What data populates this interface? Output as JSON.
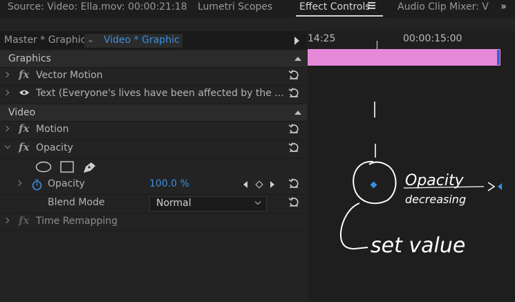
{
  "tabs": [
    {
      "label": "Source: Video: Ella.mov: 00:00:21:18"
    },
    {
      "label": "Lumetri Scopes"
    },
    {
      "label": "Effect Controls"
    },
    {
      "label": "Audio Clip Mixer: V"
    }
  ],
  "sequence_tabs": {
    "master": "Master * Graphic",
    "video": "Video * Graphic"
  },
  "sections": {
    "graphics": "Graphics",
    "video": "Video"
  },
  "graphics_rows": [
    {
      "label": "Vector Motion"
    },
    {
      "label": "Text (Everyone's lives have been affected by the ..."
    }
  ],
  "video_rows": {
    "motion": "Motion",
    "opacity": "Opacity",
    "time_remapping": "Time Remapping"
  },
  "opacity_param": {
    "label": "Opacity",
    "value": "100.0 %"
  },
  "blend_mode": {
    "label": "Blend Mode",
    "value": "Normal"
  },
  "timeline": {
    "time_left": "14:25",
    "time_right": "00:00:15:00"
  },
  "annotations": {
    "note1": "Opacity",
    "note2": "decreasing",
    "note3": "set value"
  },
  "colors": {
    "accent": "#3a8fe0",
    "clip": "#e688d8"
  }
}
